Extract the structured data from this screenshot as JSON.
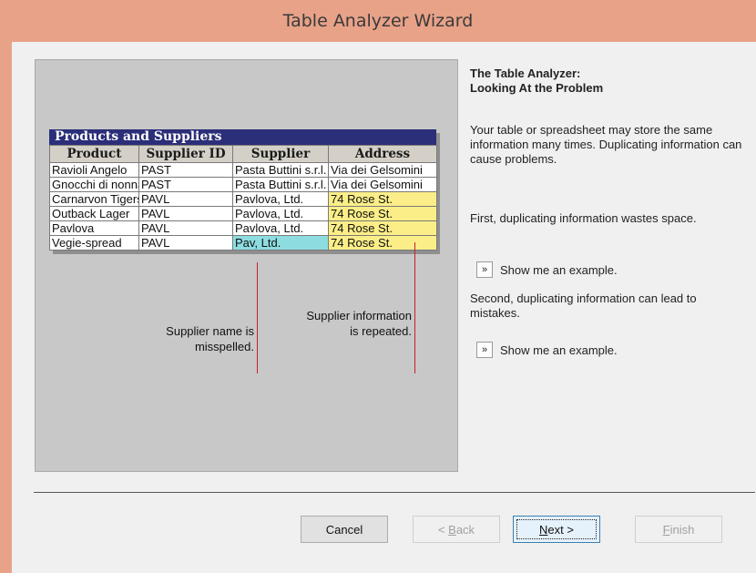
{
  "window": {
    "title": "Table Analyzer Wizard"
  },
  "illustration": {
    "table": {
      "caption": "Products and Suppliers",
      "columns": [
        "Product",
        "Supplier ID",
        "Supplier",
        "Address"
      ],
      "rows": [
        [
          "Ravioli Angelo",
          "PAST",
          "Pasta Buttini s.r.l.",
          "Via dei Gelsomini"
        ],
        [
          "Gnocchi di nonna",
          "PAST",
          "Pasta Buttini s.r.l.",
          "Via dei Gelsomini"
        ],
        [
          "Carnarvon Tigers",
          "PAVL",
          "Pavlova, Ltd.",
          "74 Rose St."
        ],
        [
          "Outback Lager",
          "PAVL",
          "Pavlova, Ltd.",
          "74 Rose St."
        ],
        [
          "Pavlova",
          "PAVL",
          "Pavlova, Ltd.",
          "74 Rose St."
        ],
        [
          "Vegie-spread",
          "PAVL",
          "Pav, Ltd.",
          "74 Rose St."
        ]
      ],
      "highlight_colors": {
        "repeated": "#fbee88",
        "misspelled": "#8ddde0"
      }
    },
    "callouts": {
      "misspelled_line1": "Supplier name is",
      "misspelled_line2": "misspelled.",
      "repeated_line1": "Supplier information",
      "repeated_line2": "is repeated.",
      "line_color": "#c8202a"
    }
  },
  "panel": {
    "heading_line1": "The Table Analyzer:",
    "heading_line2": "Looking At the Problem",
    "intro": "Your table or spreadsheet may store the same information many times. Duplicating information can cause problems.",
    "first_point": "First, duplicating information wastes space.",
    "second_point": "Second, duplicating information can lead to mistakes.",
    "example_button_icon": "double-chevron-right-icon",
    "example_button_glyph": "»",
    "example1_label": "Show me an example.",
    "example2_label": "Show me an example."
  },
  "buttons": {
    "cancel": "Cancel",
    "back_prefix": "< ",
    "back_accel": "B",
    "back_rest": "ack",
    "next_accel": "N",
    "next_rest": "ext >",
    "finish_accel": "F",
    "finish_rest": "inish"
  },
  "colors": {
    "titlebar": "#e8a288",
    "client": "#f0f0f0",
    "illustration_bg": "#c8c8c8",
    "caption_bg": "#2b2e78"
  }
}
